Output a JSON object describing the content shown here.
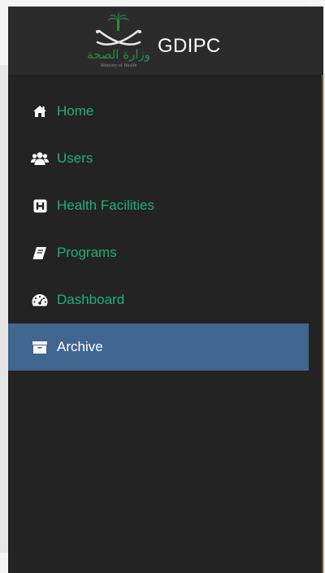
{
  "header": {
    "logo_arabic": "وزارة الصحة",
    "logo_english": "Ministry of Health",
    "brand": "GDIPC"
  },
  "menu": {
    "items": [
      {
        "label": "Home",
        "icon": "home-icon"
      },
      {
        "label": "Users",
        "icon": "users-icon"
      },
      {
        "label": "Health Facilities",
        "icon": "hospital-icon"
      },
      {
        "label": "Programs",
        "icon": "book-icon"
      },
      {
        "label": "Dashboard",
        "icon": "dashboard-icon"
      },
      {
        "label": "Archive",
        "icon": "archive-icon"
      }
    ],
    "active_index": 5
  },
  "colors": {
    "panel_bg": "#232323",
    "header_bg": "#2b2b2b",
    "link_green": "#1fb276",
    "active_bg": "#41668f",
    "active_text": "#ffffff",
    "icon_white": "#ffffff",
    "logo_green": "#2c8a46"
  }
}
